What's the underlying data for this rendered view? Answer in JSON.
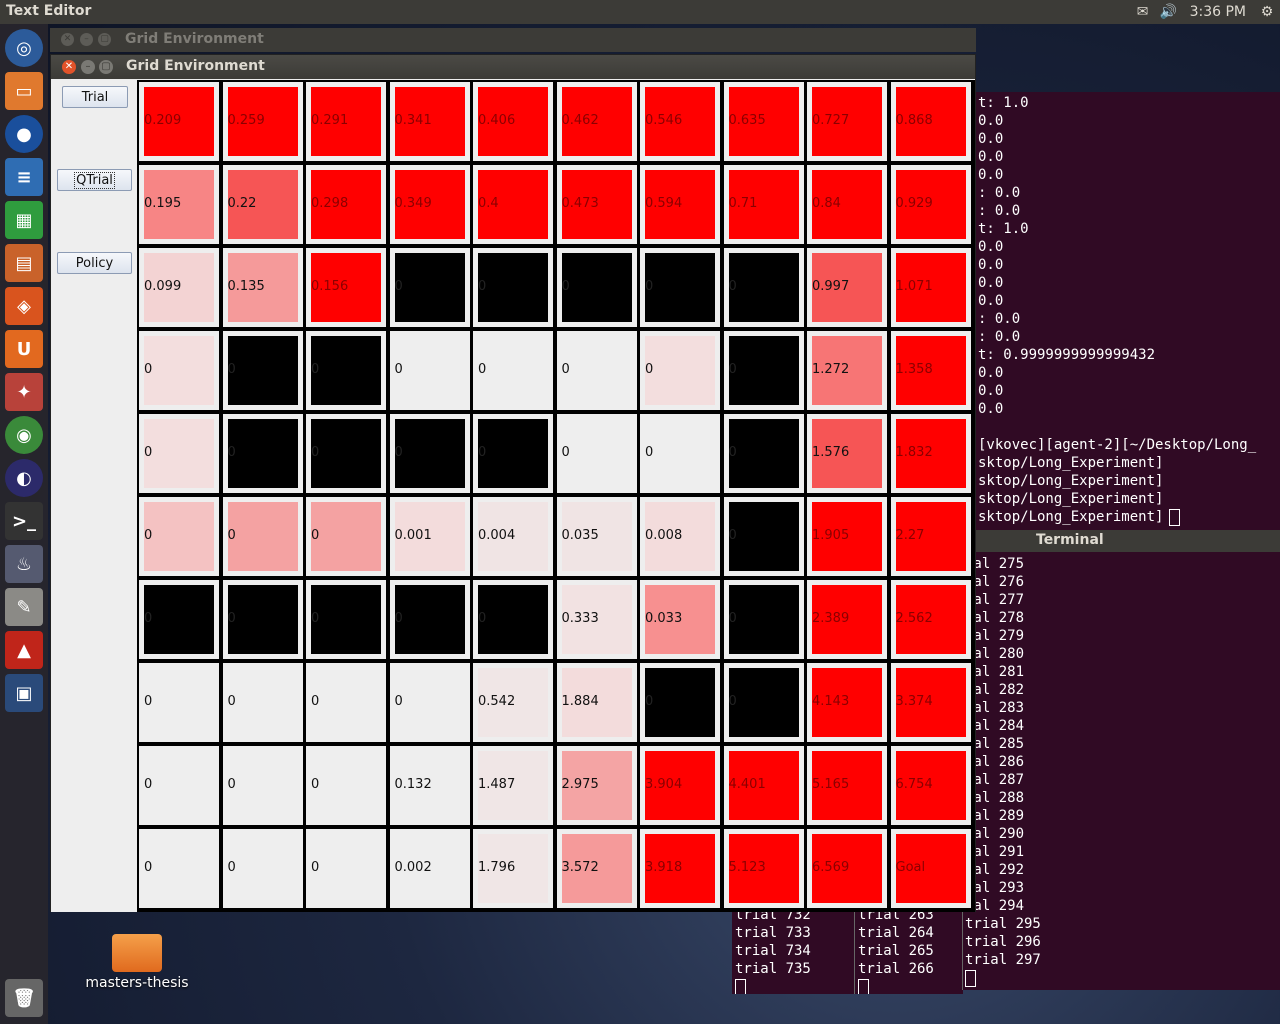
{
  "top_panel": {
    "app_title": "Text Editor",
    "clock": "3:36 PM",
    "icons": [
      "mail-icon",
      "volume-icon",
      "gear-icon"
    ]
  },
  "launcher": {
    "items": [
      "ubuntu-logo-icon",
      "files-icon",
      "firefox-icon",
      "writer-icon",
      "calc-icon",
      "impress-icon",
      "software-center-icon",
      "ubuntu-one-icon",
      "system-settings-icon",
      "chrome-icon",
      "eclipse-icon",
      "terminal-icon",
      "java-app-icon",
      "text-editor-icon",
      "pdf-reader-icon",
      "workspace-switcher-icon",
      "trash-icon"
    ]
  },
  "desktop": {
    "folder_label": "masters-thesis"
  },
  "back_window": {
    "title": "Grid Environment"
  },
  "main_window": {
    "title": "Grid Environment",
    "buttons": {
      "trial": "Trial",
      "qtrial": "QTrial",
      "policy": "Policy"
    },
    "grid": [
      [
        {
          "v": "0.209",
          "c": "#ff0000"
        },
        {
          "v": "0.259",
          "c": "#ff0000"
        },
        {
          "v": "0.291",
          "c": "#ff0000"
        },
        {
          "v": "0.341",
          "c": "#ff0000"
        },
        {
          "v": "0.406",
          "c": "#ff0000"
        },
        {
          "v": "0.462",
          "c": "#ff0000"
        },
        {
          "v": "0.546",
          "c": "#ff0000"
        },
        {
          "v": "0.635",
          "c": "#ff0000"
        },
        {
          "v": "0.727",
          "c": "#ff0000"
        },
        {
          "v": "0.868",
          "c": "#ff0000"
        }
      ],
      [
        {
          "v": "0.195",
          "c": "#f78585"
        },
        {
          "v": "0.22",
          "c": "#f65555"
        },
        {
          "v": "0.298",
          "c": "#ff0000"
        },
        {
          "v": "0.349",
          "c": "#ff0000"
        },
        {
          "v": "0.4",
          "c": "#ff0000"
        },
        {
          "v": "0.473",
          "c": "#ff0000"
        },
        {
          "v": "0.594",
          "c": "#ff0000"
        },
        {
          "v": "0.71",
          "c": "#ff0000"
        },
        {
          "v": "0.84",
          "c": "#ff0000"
        },
        {
          "v": "0.929",
          "c": "#ff0000"
        }
      ],
      [
        {
          "v": "0.099",
          "c": "#f3d3d3"
        },
        {
          "v": "0.135",
          "c": "#f59a9a"
        },
        {
          "v": "0.156",
          "c": "#ff0000"
        },
        {
          "v": "0",
          "c": "#000000"
        },
        {
          "v": "0",
          "c": "#000000"
        },
        {
          "v": "0",
          "c": "#000000"
        },
        {
          "v": "0",
          "c": "#000000"
        },
        {
          "v": "0",
          "c": "#000000"
        },
        {
          "v": "0.997",
          "c": "#f65555"
        },
        {
          "v": "1.071",
          "c": "#ff0000"
        }
      ],
      [
        {
          "v": "0",
          "c": "#f3dede"
        },
        {
          "v": "0",
          "c": "#000000"
        },
        {
          "v": "0",
          "c": "#000000"
        },
        {
          "v": "0",
          "c": "#eeeeee"
        },
        {
          "v": "0",
          "c": "#eeeeee"
        },
        {
          "v": "0",
          "c": "#eeeeee"
        },
        {
          "v": "0",
          "c": "#f3dede"
        },
        {
          "v": "0",
          "c": "#000000"
        },
        {
          "v": "1.272",
          "c": "#f77575"
        },
        {
          "v": "1.358",
          "c": "#ff0000"
        }
      ],
      [
        {
          "v": "0",
          "c": "#f3dede"
        },
        {
          "v": "0",
          "c": "#000000"
        },
        {
          "v": "0",
          "c": "#000000"
        },
        {
          "v": "0",
          "c": "#000000"
        },
        {
          "v": "0",
          "c": "#000000"
        },
        {
          "v": "0",
          "c": "#eeeeee"
        },
        {
          "v": "0",
          "c": "#eeeeee"
        },
        {
          "v": "0",
          "c": "#000000"
        },
        {
          "v": "1.576",
          "c": "#f65555"
        },
        {
          "v": "1.832",
          "c": "#ff0000"
        }
      ],
      [
        {
          "v": "0",
          "c": "#f4c2c2"
        },
        {
          "v": "0",
          "c": "#f4a2a2"
        },
        {
          "v": "0",
          "c": "#f4a2a2"
        },
        {
          "v": "0.001",
          "c": "#f3dcdc"
        },
        {
          "v": "0.004",
          "c": "#f0e4e4"
        },
        {
          "v": "0.035",
          "c": "#f0e4e4"
        },
        {
          "v": "0.008",
          "c": "#f3dcdc"
        },
        {
          "v": "0",
          "c": "#000000"
        },
        {
          "v": "1.905",
          "c": "#ff0000"
        },
        {
          "v": "2.27",
          "c": "#ff0000"
        }
      ],
      [
        {
          "v": "0",
          "c": "#000000"
        },
        {
          "v": "0",
          "c": "#000000"
        },
        {
          "v": "0",
          "c": "#000000"
        },
        {
          "v": "0",
          "c": "#000000"
        },
        {
          "v": "0",
          "c": "#000000"
        },
        {
          "v": "0.333",
          "c": "#f2e2e2"
        },
        {
          "v": "0.033",
          "c": "#f79090"
        },
        {
          "v": "0",
          "c": "#000000"
        },
        {
          "v": "2.389",
          "c": "#ff0000"
        },
        {
          "v": "2.562",
          "c": "#ff0000"
        }
      ],
      [
        {
          "v": "0",
          "c": "#eeeeee"
        },
        {
          "v": "0",
          "c": "#eeeeee"
        },
        {
          "v": "0",
          "c": "#eeeeee"
        },
        {
          "v": "0",
          "c": "#eeeeee"
        },
        {
          "v": "0.542",
          "c": "#f0e6e6"
        },
        {
          "v": "1.884",
          "c": "#f3dcdc"
        },
        {
          "v": "0",
          "c": "#000000"
        },
        {
          "v": "0",
          "c": "#000000"
        },
        {
          "v": "4.143",
          "c": "#ff0000"
        },
        {
          "v": "3.374",
          "c": "#ff0000"
        }
      ],
      [
        {
          "v": "0",
          "c": "#eeeeee"
        },
        {
          "v": "0",
          "c": "#eeeeee"
        },
        {
          "v": "0",
          "c": "#eeeeee"
        },
        {
          "v": "0.132",
          "c": "#eeeeee"
        },
        {
          "v": "1.487",
          "c": "#f0e6e6"
        },
        {
          "v": "2.975",
          "c": "#f4a4a4"
        },
        {
          "v": "3.904",
          "c": "#ff0000"
        },
        {
          "v": "4.401",
          "c": "#ff0000"
        },
        {
          "v": "5.165",
          "c": "#ff0000"
        },
        {
          "v": "6.754",
          "c": "#ff0000"
        }
      ],
      [
        {
          "v": "0",
          "c": "#eeeeee"
        },
        {
          "v": "0",
          "c": "#eeeeee"
        },
        {
          "v": "0",
          "c": "#eeeeee"
        },
        {
          "v": "0.002",
          "c": "#eeeeee"
        },
        {
          "v": "1.796",
          "c": "#f0e6e6"
        },
        {
          "v": "3.572",
          "c": "#f59a9a"
        },
        {
          "v": "3.918",
          "c": "#ff0000"
        },
        {
          "v": "5.123",
          "c": "#ff0000"
        },
        {
          "v": "6.569",
          "c": "#ff0000"
        },
        {
          "v": "Goal",
          "c": "#ff0000"
        }
      ]
    ]
  },
  "terminal_top": {
    "lines": [
      "t: 1.0",
      "0.0",
      "0.0",
      "0.0",
      "0.0",
      ": 0.0",
      ": 0.0",
      "t: 1.0",
      "0.0",
      "0.0",
      "0.0",
      "0.0",
      ": 0.0",
      ": 0.0",
      "t: 0.9999999999999432",
      "0.0",
      "0.0",
      "0.0",
      "",
      "[vkovec][agent-2][~/Desktop/Long_",
      "sktop/Long_Experiment]",
      "sktop/Long_Experiment]",
      "sktop/Long_Experiment]",
      "sktop/Long_Experiment]"
    ]
  },
  "terminal_right": {
    "title": "Terminal",
    "lines": [
      "ial 275",
      "ial 276",
      "ial 277",
      "ial 278",
      "ial 279",
      "ial 280",
      "ial 281",
      "ial 282",
      "ial 283",
      "ial 284",
      "ial 285",
      "ial 286",
      "ial 287",
      "ial 288",
      "ial 289",
      "ial 290",
      "ial 291",
      "ial 292",
      "ial 293",
      "ial 294",
      "trial 295",
      "trial 296",
      "trial 297"
    ]
  },
  "terminal_bl1": {
    "lines": [
      "trial 732",
      "trial 733",
      "trial 734",
      "trial 735"
    ]
  },
  "terminal_bl2": {
    "lines": [
      "trial 263",
      "trial 264",
      "trial 265",
      "trial 266"
    ]
  }
}
